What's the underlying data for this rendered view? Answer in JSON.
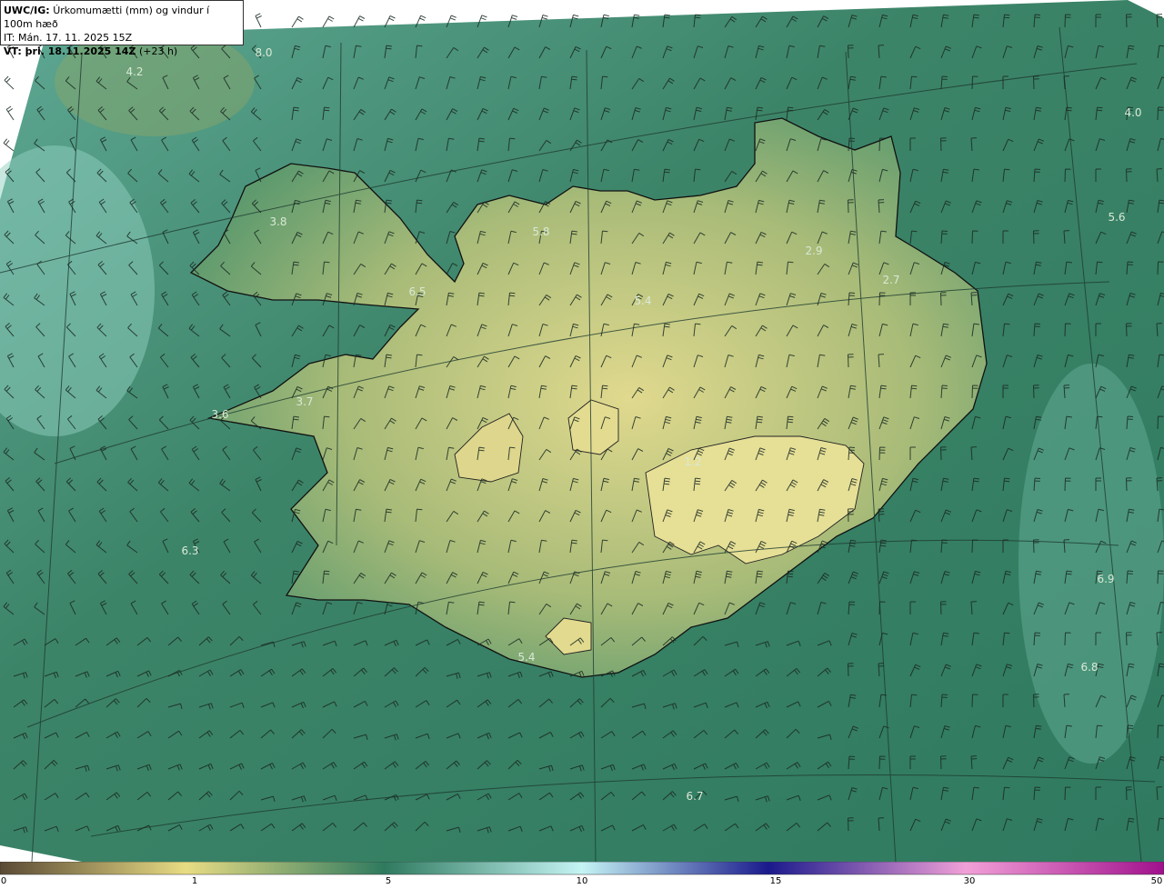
{
  "header": {
    "product": "UWC/IG:",
    "title": "Úrkomumætti (mm) og vindur í 100m hæð",
    "init_time": "IT: Mán. 17. 11. 2025 15Z",
    "valid_time_label": "VT: þri. 18.11.2025 14Z",
    "valid_time_offset": "(+23 h)"
  },
  "colorbar": {
    "ticks": [
      "0",
      "1",
      "5",
      "10",
      "15",
      "30",
      "50"
    ],
    "colors": [
      "#5a4a35",
      "#e8dc84",
      "#2f7a5f",
      "#c5f4f4",
      "#1a1a8c",
      "#f2a0d8",
      "#a0108c"
    ]
  },
  "values": [
    "4.2",
    "8.0",
    "4.0",
    "3.8",
    "5.8",
    "2.9",
    "2.7",
    "5.6",
    "6.5",
    "5.4",
    "3.7",
    "3.6",
    "1.2",
    "6.3",
    "6.9",
    "5.4",
    "6.8",
    "6.7"
  ],
  "colors": {
    "ocean": "#3f8a6a",
    "land": "#c9c77a",
    "coast": "#111111"
  }
}
